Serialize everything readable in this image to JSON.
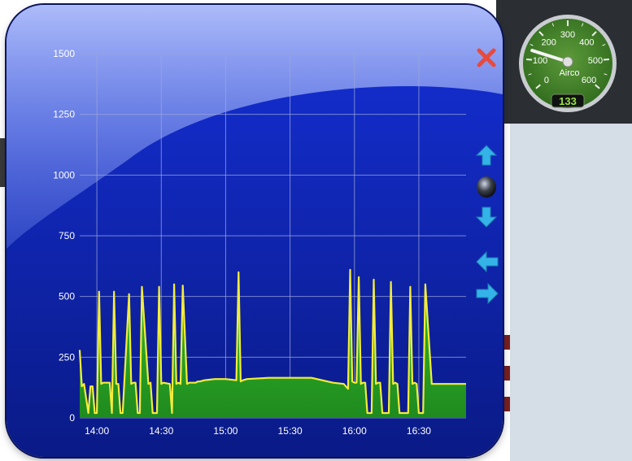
{
  "colors": {
    "line": "#f2ec3c",
    "fill": "#2fb02a",
    "grid": "#9aa6d8",
    "tick_text": "#ffffff",
    "close": "#e84a3c",
    "arrow": "#34b3e8"
  },
  "controls": {
    "close_icon": "close-x-icon",
    "up_icon": "arrow-up-icon",
    "center_icon": "center-dot-icon",
    "down_icon": "arrow-down-icon",
    "left_icon": "arrow-left-icon",
    "right_icon": "arrow-right-icon"
  },
  "chart_data": {
    "type": "area",
    "title": "",
    "xlabel": "",
    "ylabel": "",
    "ylim": [
      0,
      1500
    ],
    "xlim": [
      "13:52",
      "16:52"
    ],
    "yticks": [
      0,
      250,
      500,
      750,
      1000,
      1250,
      1500
    ],
    "xticks": [
      "14:00",
      "14:30",
      "15:00",
      "15:30",
      "16:00",
      "16:30"
    ],
    "grid": true,
    "legend": "none",
    "series": [
      {
        "x": [
          "13:52",
          "13:53",
          "13:54",
          "13:56",
          "13:57",
          "13:58",
          "13:59",
          "14:00",
          "14:01",
          "14:02",
          "14:03",
          "14:06",
          "14:07",
          "14:08",
          "14:09",
          "14:10",
          "14:11",
          "14:12",
          "14:15",
          "14:16",
          "14:17",
          "14:18",
          "14:19",
          "14:20",
          "14:21",
          "14:24",
          "14:25",
          "14:26",
          "14:27",
          "14:28",
          "14:29",
          "14:30",
          "14:31",
          "14:34",
          "14:35",
          "14:36",
          "14:37",
          "14:38",
          "14:39",
          "14:40",
          "14:42",
          "14:43",
          "14:44",
          "14:45",
          "14:46",
          "14:47",
          "14:48",
          "14:50",
          "14:55",
          "15:00",
          "15:05",
          "15:06",
          "15:07",
          "15:08",
          "15:10",
          "15:20",
          "15:30",
          "15:40",
          "15:50",
          "15:55",
          "15:56",
          "15:57",
          "15:58",
          "15:59",
          "16:00",
          "16:01",
          "16:02",
          "16:03",
          "16:04",
          "16:05",
          "16:06",
          "16:08",
          "16:09",
          "16:10",
          "16:11",
          "16:12",
          "16:13",
          "16:15",
          "16:16",
          "16:17",
          "16:18",
          "16:19",
          "16:20",
          "16:21",
          "16:22",
          "16:25",
          "16:26",
          "16:27",
          "16:28",
          "16:29",
          "16:30",
          "16:31",
          "16:32",
          "16:33",
          "16:36",
          "16:37",
          "16:38",
          "16:39",
          "16:40",
          "16:42",
          "16:43",
          "16:44",
          "16:52"
        ],
        "y": [
          280,
          130,
          140,
          20,
          130,
          130,
          20,
          20,
          520,
          140,
          145,
          145,
          20,
          520,
          140,
          140,
          20,
          20,
          510,
          140,
          145,
          145,
          20,
          20,
          540,
          140,
          145,
          20,
          20,
          20,
          540,
          140,
          145,
          140,
          20,
          550,
          140,
          145,
          140,
          545,
          140,
          145,
          145,
          145,
          145,
          150,
          150,
          155,
          160,
          160,
          155,
          600,
          150,
          155,
          160,
          165,
          165,
          165,
          145,
          140,
          130,
          120,
          610,
          150,
          145,
          145,
          580,
          140,
          145,
          145,
          20,
          20,
          570,
          140,
          145,
          145,
          20,
          20,
          20,
          560,
          140,
          145,
          140,
          20,
          20,
          20,
          540,
          140,
          145,
          140,
          20,
          20,
          20,
          550,
          140,
          140,
          140,
          140,
          140,
          140,
          140,
          140,
          140
        ]
      }
    ]
  },
  "gauge": {
    "label": "Airco",
    "ticks": [
      "0",
      "100",
      "200",
      "300",
      "400",
      "500",
      "600"
    ],
    "value": 133,
    "display": "133",
    "min": 0,
    "max": 600
  }
}
